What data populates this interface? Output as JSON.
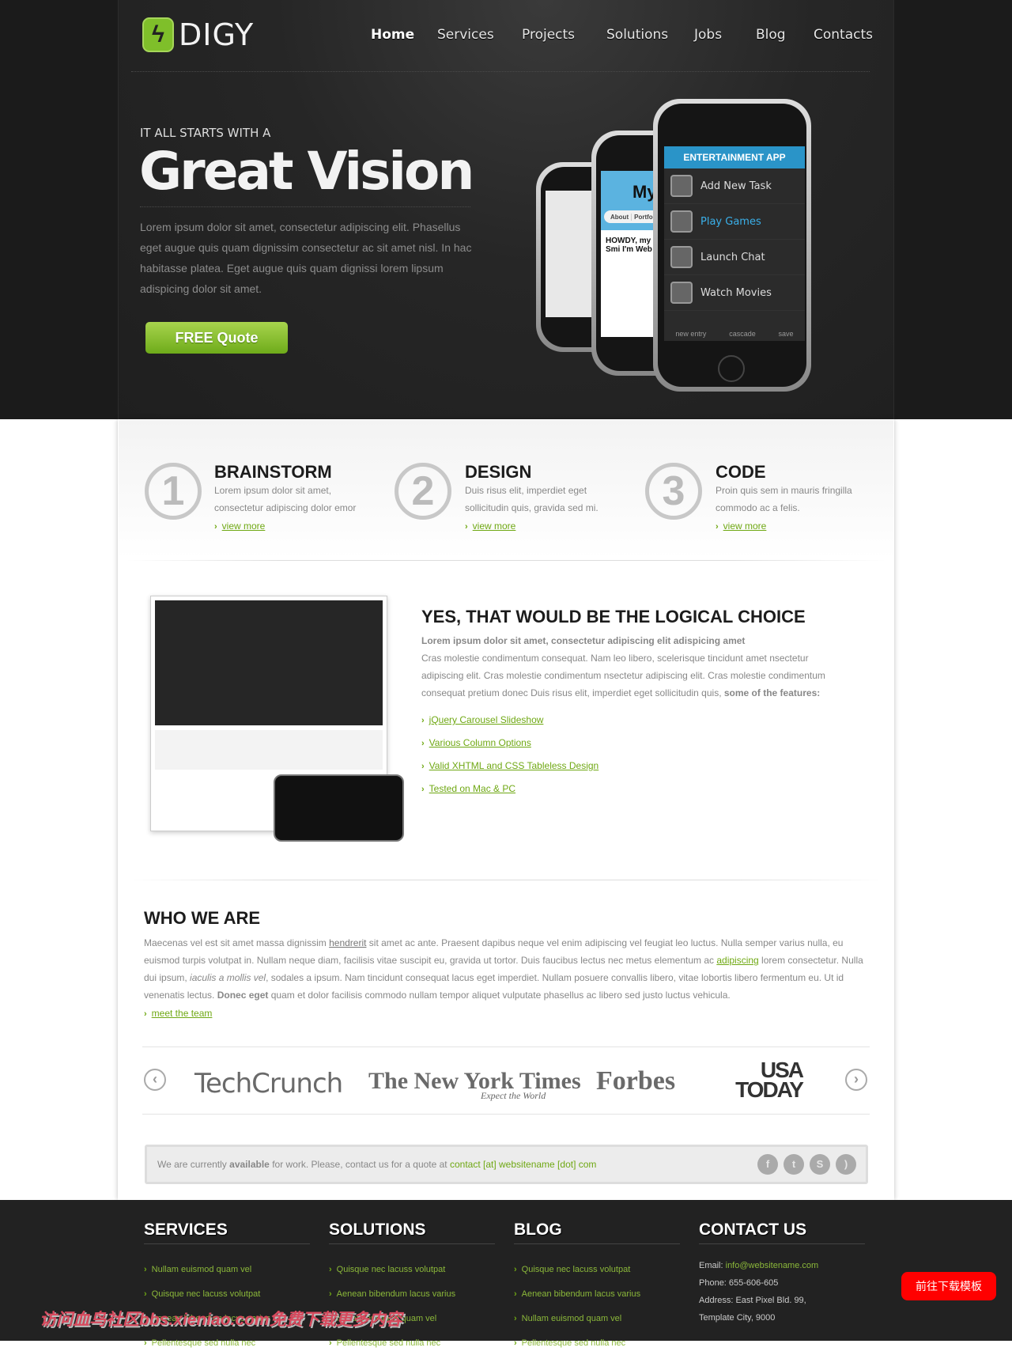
{
  "brand": {
    "name": "DIGY",
    "accent": "#6fa813"
  },
  "nav": [
    "Home",
    "Services",
    "Projects",
    "Solutions",
    "Jobs",
    "Blog",
    "Contacts"
  ],
  "hero": {
    "kicker": "IT ALL STARTS WITH A",
    "title": "Great Vision",
    "text": "Lorem ipsum dolor sit amet, consectetur adipiscing elit. Phasellus eget augue quis quam dignissim consectetur ac sit amet nisl. In hac habitasse platea. Eget augue quis quam dignissi lorem lipsum adispicing dolor sit amet.",
    "button": "FREE Quote"
  },
  "phone": {
    "header": "ENTERTAINMENT APP",
    "rows": [
      "Add New Task",
      "Play Games",
      "Launch Chat",
      "Watch Movies"
    ],
    "tabs": [
      "new entry",
      "cascade",
      "save"
    ],
    "mid_title": "MyP",
    "mid_tabs": [
      "About",
      "Portfolio"
    ],
    "mid_text": "HOWDY, my is John Smi I'm Web Dev"
  },
  "steps": [
    {
      "num": "1",
      "title": "BRAINSTORM",
      "text": "Lorem ipsum dolor sit amet, consectetur adipiscing dolor emor",
      "link": "view more"
    },
    {
      "num": "2",
      "title": "DESIGN",
      "text": "Duis risus elit, imperdiet eget sollicitudin quis, gravida sed mi.",
      "link": "view more"
    },
    {
      "num": "3",
      "title": "CODE",
      "text": "Proin quis sem in mauris fringilla commodo ac a felis.",
      "link": "view more"
    }
  ],
  "choice": {
    "title": "YES, THAT WOULD BE THE LOGICAL CHOICE",
    "lead": "Lorem ipsum dolor sit amet, consectetur adipiscing elit adispicing amet",
    "text": "Cras molestie condimentum consequat. Nam leo libero, scelerisque tincidunt amet nsectetur adipiscing elit. Cras molestie condimentum nsectetur adipiscing elit. Cras molestie condimentum consequat pretium donec Duis risus elit, imperdiet eget sollicitudin quis,",
    "text_bold": "some of the features:",
    "features": [
      "jQuery Carousel Slideshow",
      "Various Column Options",
      "Valid XHTML and CSS Tableless Design",
      "Tested on Mac & PC"
    ]
  },
  "who": {
    "title": "WHO WE ARE",
    "p1": "Maecenas vel est sit amet massa dignissim ",
    "l1": "hendrerit",
    "p2": " sit amet ac ante. Praesent dapibus neque vel enim adipiscing vel feugiat leo luctus. Nulla semper varius nulla, eu euismod turpis volutpat in. Nullam neque diam, facilisis vitae suscipit eu, gravida ut tortor. Duis faucibus lectus nec metus elementum ac ",
    "l2": "adipiscing",
    "p3": " lorem consectetur. Nulla dui ipsum, ",
    "i1": "iaculis a mollis vel",
    "p4": ", sodales a ipsum. Nam tincidunt consequat lacus eget imperdiet. Nullam posuere convallis libero, vitae lobortis libero fermentum eu. Ut id venenatis lectus. ",
    "b1": "Donec eget",
    "p5": " quam et dolor facilisis commodo nullam tempor aliquet vulputate phasellus ac libero sed justo luctus vehicula.",
    "link": "meet the team"
  },
  "press": [
    "TechCrunch",
    "The New York Times",
    "Expect the World",
    "Forbes",
    "USA TODAY"
  ],
  "contact_bar": {
    "t1": "We are currently ",
    "b": "available",
    "t2": " for work. Please, contact us for a quote at ",
    "link": "contact [at] websitename [dot] com",
    "social": [
      "facebook",
      "twitter",
      "skype",
      "rss"
    ]
  },
  "footer": {
    "services": {
      "title": "SERVICES",
      "items": [
        "Nullam euismod quam vel",
        "Quisque nec lacuss volutpat",
        "Aenean bibendum lacus varius",
        "Pellentesque sed nulla nec"
      ]
    },
    "solutions": {
      "title": "SOLUTIONS",
      "items": [
        "Quisque nec lacuss volutpat",
        "Aenean bibendum lacus varius",
        "Nullam euismod quam vel",
        "Pellentesque sed nulla nec"
      ]
    },
    "blog": {
      "title": "BLOG",
      "items": [
        "Quisque nec lacuss volutpat",
        "Aenean bibendum lacus varius",
        "Nullam euismod quam vel",
        "Pellentesque sed nulla nec"
      ]
    },
    "contact": {
      "title": "CONTACT US",
      "email_label": "Email: ",
      "email": "info@websitename.com",
      "phone": "Phone: 655-606-605",
      "address1": "Address: East Pixel Bld. 99,",
      "address2": "Template City, 9000"
    }
  },
  "download_button": "前往下载模板",
  "watermark": "访问血鸟社区bbs.xieniao.com免费下载更多内容"
}
